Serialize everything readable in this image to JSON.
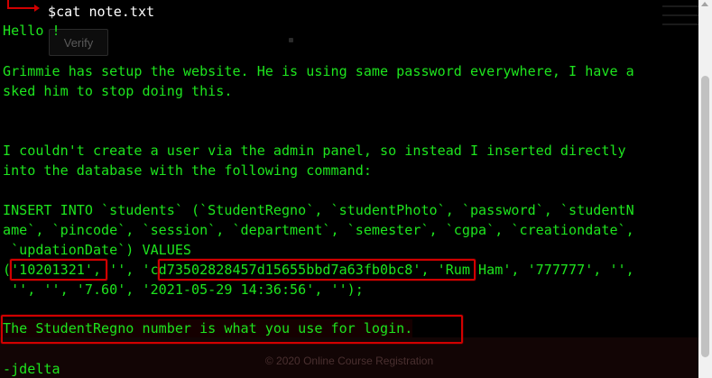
{
  "terminal": {
    "prompt_symbol": "$",
    "command": "cat note.txt",
    "lines": [
      "Hello !",
      "Grimmie has setup the website. He is using same password everywhere, I have a",
      "sked him to stop doing this.",
      "I couldn't create a user via the admin panel, so instead I inserted directly",
      "into the database with the following command:",
      "INSERT INTO `students` (`StudentRegno`, `studentPhoto`, `password`, `studentN",
      "ame`, `pincode`, `session`, `department`, `semester`, `cgpa`, `creationdate`,",
      " `updationDate`) VALUES",
      "('10201321', '', 'cd73502828457d15655bbd7a63fb0bc8', 'Rum Ham', '777777', '',",
      " '', '', '7.60', '2021-05-29 14:36:56', '');",
      "The StudentRegno number is what you use for login.",
      "-jdelta"
    ]
  },
  "background_page": {
    "button_label": "Verify",
    "footer_text": "© 2020 Online Course Registration"
  },
  "colors": {
    "terminal_text": "#1ee51e",
    "highlight_border": "#d10000",
    "prompt_accent": "#d00000"
  }
}
